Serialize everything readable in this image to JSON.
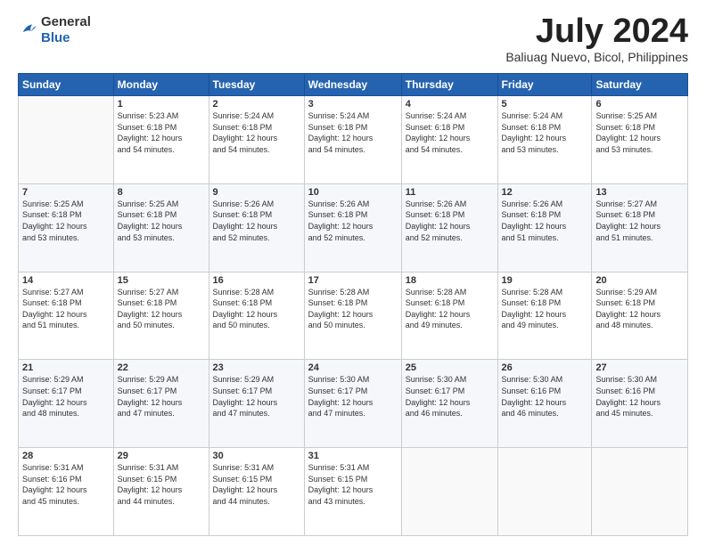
{
  "header": {
    "logo_line1": "General",
    "logo_line2": "Blue",
    "month_year": "July 2024",
    "location": "Baliuag Nuevo, Bicol, Philippines"
  },
  "days_of_week": [
    "Sunday",
    "Monday",
    "Tuesday",
    "Wednesday",
    "Thursday",
    "Friday",
    "Saturday"
  ],
  "weeks": [
    [
      {
        "day": "",
        "info": ""
      },
      {
        "day": "1",
        "info": "Sunrise: 5:23 AM\nSunset: 6:18 PM\nDaylight: 12 hours\nand 54 minutes."
      },
      {
        "day": "2",
        "info": "Sunrise: 5:24 AM\nSunset: 6:18 PM\nDaylight: 12 hours\nand 54 minutes."
      },
      {
        "day": "3",
        "info": "Sunrise: 5:24 AM\nSunset: 6:18 PM\nDaylight: 12 hours\nand 54 minutes."
      },
      {
        "day": "4",
        "info": "Sunrise: 5:24 AM\nSunset: 6:18 PM\nDaylight: 12 hours\nand 54 minutes."
      },
      {
        "day": "5",
        "info": "Sunrise: 5:24 AM\nSunset: 6:18 PM\nDaylight: 12 hours\nand 53 minutes."
      },
      {
        "day": "6",
        "info": "Sunrise: 5:25 AM\nSunset: 6:18 PM\nDaylight: 12 hours\nand 53 minutes."
      }
    ],
    [
      {
        "day": "7",
        "info": "Sunrise: 5:25 AM\nSunset: 6:18 PM\nDaylight: 12 hours\nand 53 minutes."
      },
      {
        "day": "8",
        "info": "Sunrise: 5:25 AM\nSunset: 6:18 PM\nDaylight: 12 hours\nand 53 minutes."
      },
      {
        "day": "9",
        "info": "Sunrise: 5:26 AM\nSunset: 6:18 PM\nDaylight: 12 hours\nand 52 minutes."
      },
      {
        "day": "10",
        "info": "Sunrise: 5:26 AM\nSunset: 6:18 PM\nDaylight: 12 hours\nand 52 minutes."
      },
      {
        "day": "11",
        "info": "Sunrise: 5:26 AM\nSunset: 6:18 PM\nDaylight: 12 hours\nand 52 minutes."
      },
      {
        "day": "12",
        "info": "Sunrise: 5:26 AM\nSunset: 6:18 PM\nDaylight: 12 hours\nand 51 minutes."
      },
      {
        "day": "13",
        "info": "Sunrise: 5:27 AM\nSunset: 6:18 PM\nDaylight: 12 hours\nand 51 minutes."
      }
    ],
    [
      {
        "day": "14",
        "info": "Sunrise: 5:27 AM\nSunset: 6:18 PM\nDaylight: 12 hours\nand 51 minutes."
      },
      {
        "day": "15",
        "info": "Sunrise: 5:27 AM\nSunset: 6:18 PM\nDaylight: 12 hours\nand 50 minutes."
      },
      {
        "day": "16",
        "info": "Sunrise: 5:28 AM\nSunset: 6:18 PM\nDaylight: 12 hours\nand 50 minutes."
      },
      {
        "day": "17",
        "info": "Sunrise: 5:28 AM\nSunset: 6:18 PM\nDaylight: 12 hours\nand 50 minutes."
      },
      {
        "day": "18",
        "info": "Sunrise: 5:28 AM\nSunset: 6:18 PM\nDaylight: 12 hours\nand 49 minutes."
      },
      {
        "day": "19",
        "info": "Sunrise: 5:28 AM\nSunset: 6:18 PM\nDaylight: 12 hours\nand 49 minutes."
      },
      {
        "day": "20",
        "info": "Sunrise: 5:29 AM\nSunset: 6:18 PM\nDaylight: 12 hours\nand 48 minutes."
      }
    ],
    [
      {
        "day": "21",
        "info": "Sunrise: 5:29 AM\nSunset: 6:17 PM\nDaylight: 12 hours\nand 48 minutes."
      },
      {
        "day": "22",
        "info": "Sunrise: 5:29 AM\nSunset: 6:17 PM\nDaylight: 12 hours\nand 47 minutes."
      },
      {
        "day": "23",
        "info": "Sunrise: 5:29 AM\nSunset: 6:17 PM\nDaylight: 12 hours\nand 47 minutes."
      },
      {
        "day": "24",
        "info": "Sunrise: 5:30 AM\nSunset: 6:17 PM\nDaylight: 12 hours\nand 47 minutes."
      },
      {
        "day": "25",
        "info": "Sunrise: 5:30 AM\nSunset: 6:17 PM\nDaylight: 12 hours\nand 46 minutes."
      },
      {
        "day": "26",
        "info": "Sunrise: 5:30 AM\nSunset: 6:16 PM\nDaylight: 12 hours\nand 46 minutes."
      },
      {
        "day": "27",
        "info": "Sunrise: 5:30 AM\nSunset: 6:16 PM\nDaylight: 12 hours\nand 45 minutes."
      }
    ],
    [
      {
        "day": "28",
        "info": "Sunrise: 5:31 AM\nSunset: 6:16 PM\nDaylight: 12 hours\nand 45 minutes."
      },
      {
        "day": "29",
        "info": "Sunrise: 5:31 AM\nSunset: 6:15 PM\nDaylight: 12 hours\nand 44 minutes."
      },
      {
        "day": "30",
        "info": "Sunrise: 5:31 AM\nSunset: 6:15 PM\nDaylight: 12 hours\nand 44 minutes."
      },
      {
        "day": "31",
        "info": "Sunrise: 5:31 AM\nSunset: 6:15 PM\nDaylight: 12 hours\nand 43 minutes."
      },
      {
        "day": "",
        "info": ""
      },
      {
        "day": "",
        "info": ""
      },
      {
        "day": "",
        "info": ""
      }
    ]
  ]
}
